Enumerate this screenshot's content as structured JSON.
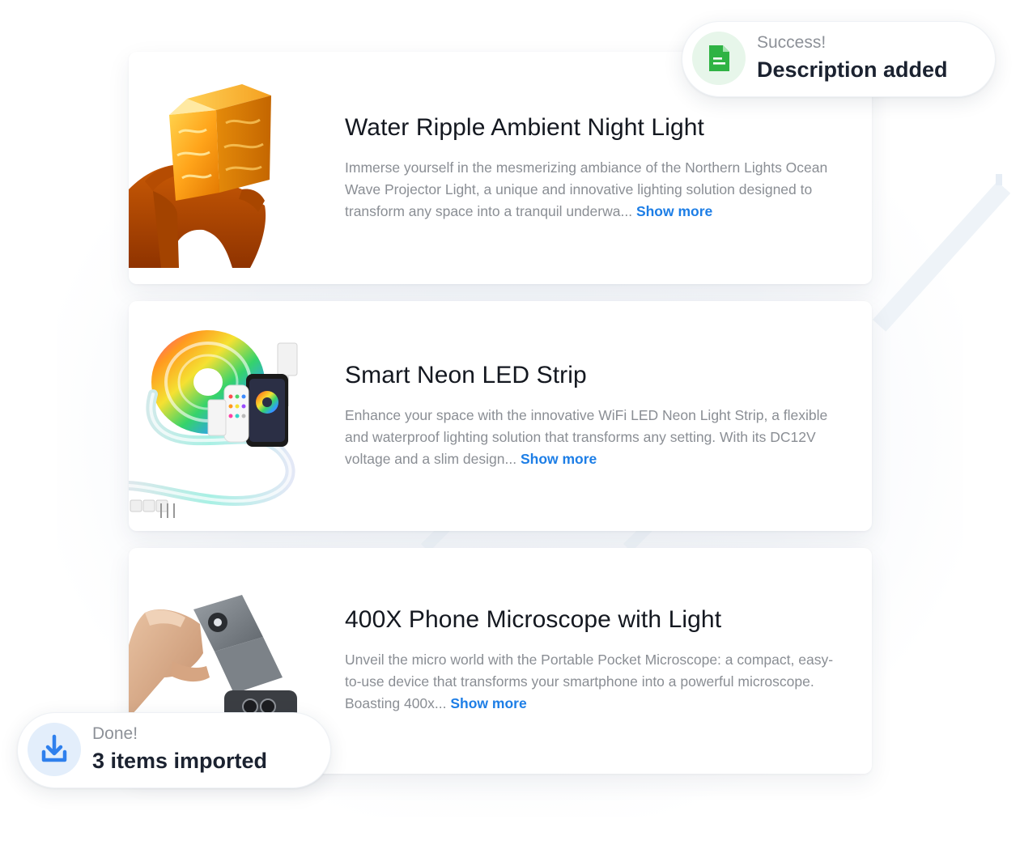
{
  "products": [
    {
      "title": "Water Ripple Ambient Night Light",
      "description": "Immerse yourself in the mesmerizing ambiance of the Northern Lights Ocean Wave Projector Light, a unique and innovative lighting solution designed to transform any space into a tranquil underwa...",
      "show_more": "Show more",
      "image_icon": "glowing-cube-lamp-image"
    },
    {
      "title": "Smart Neon LED Strip",
      "description": "Enhance your space with the innovative WiFi LED Neon Light Strip, a flexible and waterproof lighting solution that transforms any setting. With its DC12V voltage and a slim design...",
      "show_more": "Show more",
      "image_icon": "rgb-led-strip-image"
    },
    {
      "title": "400X Phone Microscope with Light",
      "description": "Unveil the micro world with the Portable Pocket Microscope: a compact, easy-to-use device that transforms your smartphone into a powerful microscope. Boasting 400x...",
      "show_more": "Show more",
      "image_icon": "phone-microscope-image"
    }
  ],
  "toasts": {
    "success": {
      "label": "Success!",
      "message": "Description added",
      "icon": "document-icon",
      "accent": "#2fb344",
      "background": "#e7f6ea"
    },
    "done": {
      "label": "Done!",
      "message": "3 items imported",
      "icon": "download-icon",
      "accent": "#2f80ed",
      "background": "#e3eefb"
    }
  },
  "colors": {
    "title": "#141820",
    "description": "#8a8e94",
    "link": "#1d7ee6"
  }
}
